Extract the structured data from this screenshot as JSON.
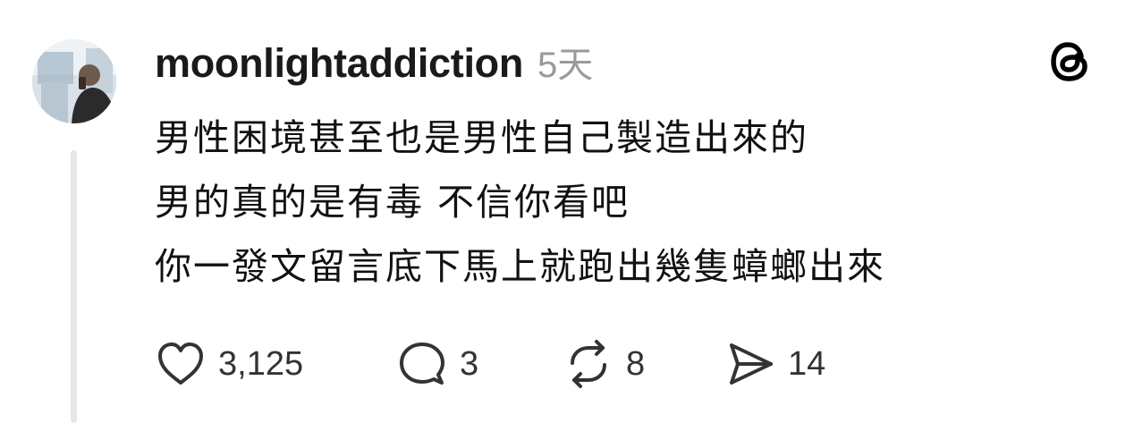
{
  "post": {
    "username": "moonlightaddiction",
    "timestamp": "5天",
    "avatar_icon": "profile-photo",
    "lines": [
      "男性困境甚至也是男性自己製造出來的",
      "男的真的是有毒 不信你看吧",
      "你一發文留言底下馬上就跑出幾隻蟑螂出來"
    ]
  },
  "actions": {
    "like": {
      "icon": "heart-icon",
      "count": "3,125"
    },
    "comment": {
      "icon": "speech-bubble-icon",
      "count": "3"
    },
    "repost": {
      "icon": "repost-arrows-icon",
      "count": "8"
    },
    "share": {
      "icon": "paper-plane-icon",
      "count": "14"
    }
  },
  "brand": {
    "logo": "threads-logo-icon",
    "color": "#000000"
  },
  "colors": {
    "text": "#111111",
    "muted": "#9a9a9a",
    "thread_line": "#e6e6e6"
  }
}
